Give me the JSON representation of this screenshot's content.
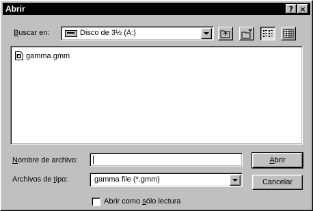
{
  "window": {
    "title": "Abrir",
    "help_button": "?",
    "close_button": "×"
  },
  "look_in": {
    "label_underlined": "B",
    "label_rest": "uscar en:",
    "value": "Disco de 3½ (A:)"
  },
  "toolbar": {
    "up_icon": "up-one-level-icon",
    "new_folder_icon": "new-folder-icon",
    "list_icon": "list-view-icon",
    "details_icon": "details-view-icon"
  },
  "files": [
    {
      "name": "gamma.gmm",
      "icon": "file-icon"
    }
  ],
  "file_name": {
    "label_underlined": "N",
    "label_rest": "ombre de archivo:",
    "value": ""
  },
  "file_type": {
    "label_pre": "Archivos de ",
    "label_underlined": "t",
    "label_rest": "ipo:",
    "value": "gamma file (*.gmm)"
  },
  "buttons": {
    "open_underlined": "A",
    "open_rest": "brir",
    "cancel": "Cancelar"
  },
  "readonly": {
    "label_pre": "Abrir como ",
    "label_underlined": "s",
    "label_rest": "ólo lectura",
    "checked": false
  }
}
